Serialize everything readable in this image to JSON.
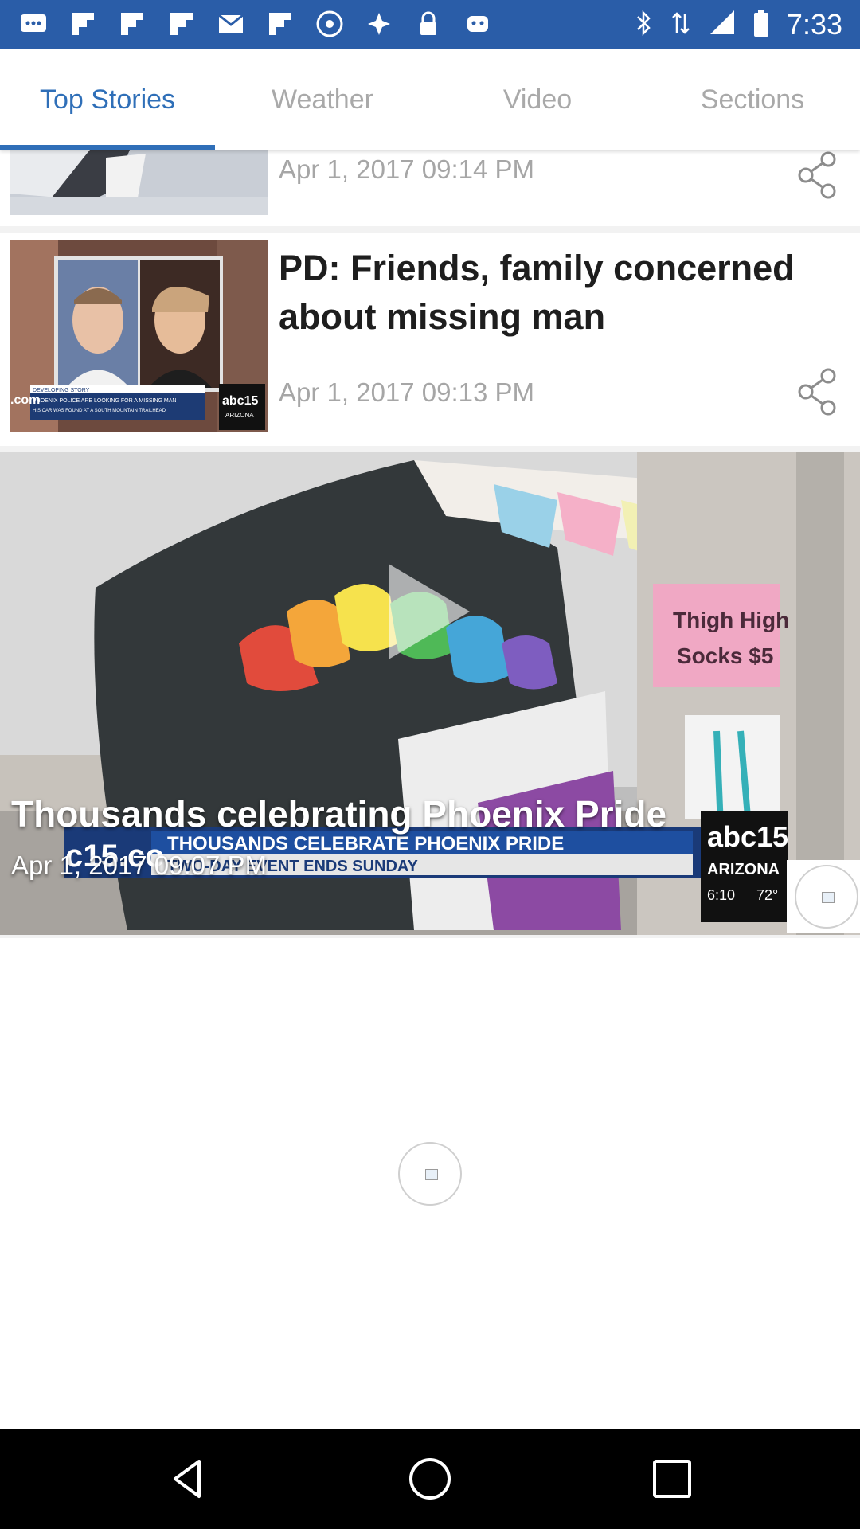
{
  "status_bar": {
    "time": "7:33",
    "background": "#2a5da8",
    "left_icons": [
      "messages-icon",
      "flipboard-icon",
      "flipboard-icon",
      "flipboard-icon",
      "gmail-icon",
      "flipboard-icon",
      "disc-icon",
      "fake-gps-icon",
      "lock-icon",
      "android-icon"
    ],
    "right_icons": [
      "bluetooth-icon",
      "data-icon",
      "signal-icon",
      "battery-icon"
    ]
  },
  "tabs": {
    "items": [
      {
        "label": "Top Stories",
        "active": true
      },
      {
        "label": "Weather",
        "active": false
      },
      {
        "label": "Video",
        "active": false
      },
      {
        "label": "Sections",
        "active": false
      }
    ],
    "accent": "#2f6fb8",
    "inactive_color": "#a9a9a9"
  },
  "feed": {
    "stories": [
      {
        "headline": "",
        "date": "Apr 1, 2017 09:14 PM"
      },
      {
        "headline": "PD: Friends, family concerned about missing man",
        "date": "Apr 1, 2017 09:13 PM",
        "thumb_text": {
          "banner_top": "DEVELOPING STORY",
          "banner_main": "PHOENIX POLICE ARE LOOKING FOR A MISSING MAN",
          "banner_sub": "HIS CAR WAS FOUND AT A SOUTH MOUNTAIN TRAILHEAD",
          "logo": "abc15",
          "logo_sub": "ARIZONA",
          "site": ".com"
        }
      }
    ],
    "video": {
      "title": "Thousands celebrating Phoenix Pride",
      "date": "Apr 1, 2017 09:07 PM",
      "overlay": {
        "ticker_main": "THOUSANDS CELEBRATE PHOENIX PRIDE",
        "ticker_sub": "TWO-DAY EVENT ENDS SUNDAY",
        "site": "c15.co",
        "logo": "abc15",
        "logo_sub": "ARIZONA",
        "clock": "6:10",
        "temp": "72°",
        "sign_line1": "Thigh High",
        "sign_line2": "Socks $5"
      }
    }
  },
  "icons": {
    "share": "share-icon",
    "play": "play-icon",
    "back": "back-icon",
    "home": "home-icon",
    "recents": "recents-icon",
    "broken_image": "broken-image-icon"
  }
}
